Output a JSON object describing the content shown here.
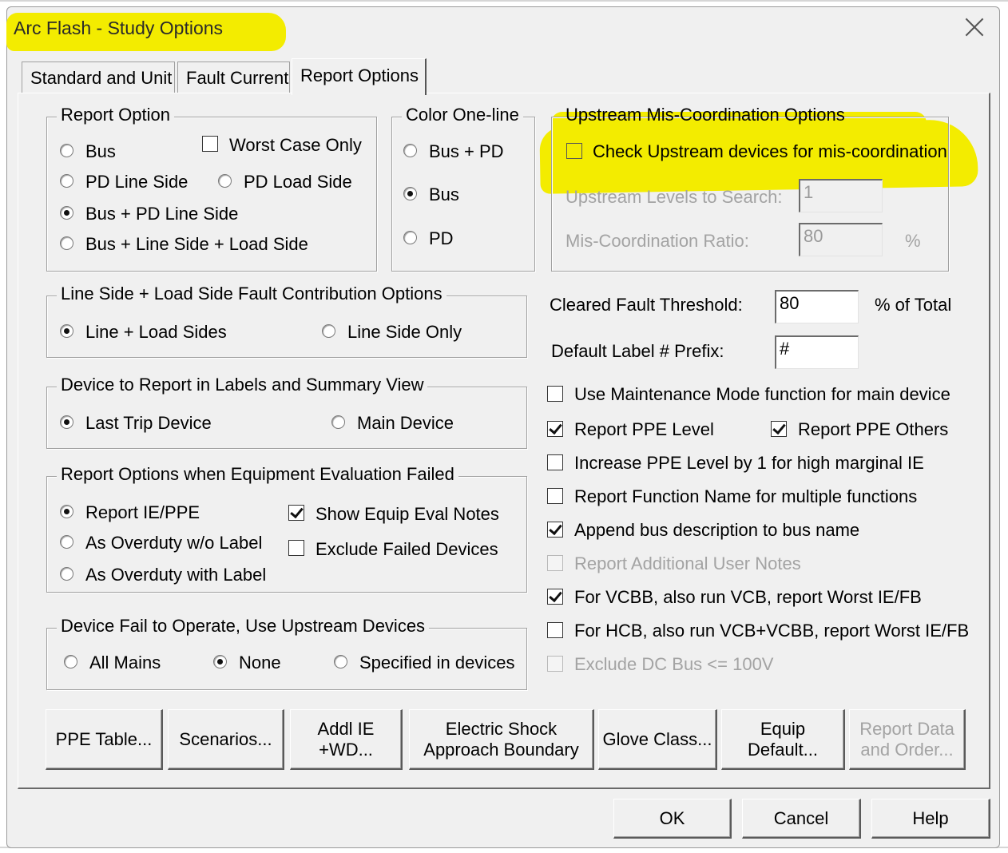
{
  "window": {
    "title": "Arc Flash - Study Options"
  },
  "tabs": [
    {
      "label": "Standard and Unit"
    },
    {
      "label": "Fault Current"
    },
    {
      "label": "Report Options"
    }
  ],
  "report_option": {
    "label": "Report Option",
    "bus": "Bus",
    "pd_line_side": "PD Line Side",
    "bus_pd_line_side": "Bus + PD Line Side",
    "bus_line_load": "Bus + Line Side + Load Side",
    "worst_case_only": "Worst Case Only",
    "pd_load_side": "PD Load Side",
    "selected": "Bus + PD Line Side"
  },
  "color_oneline": {
    "label": "Color One-line",
    "bus_pd": "Bus + PD",
    "bus": "Bus",
    "pd": "PD",
    "selected": "Bus"
  },
  "upstream": {
    "label": "Upstream Mis-Coordination Options",
    "check_label": "Check Upstream devices for mis-coordination",
    "levels_label": "Upstream Levels to Search:",
    "levels_value": "1",
    "ratio_label": "Mis-Coordination Ratio:",
    "ratio_value": "80",
    "ratio_unit": "%"
  },
  "line_load": {
    "label": "Line Side + Load Side Fault Contribution Options",
    "line_load_sides": "Line + Load Sides",
    "line_side_only": "Line Side Only",
    "selected": "Line + Load Sides"
  },
  "device_report": {
    "label": "Device to Report in Labels and Summary View",
    "last_trip": "Last Trip Device",
    "main_device": "Main Device",
    "selected": "Last Trip Device"
  },
  "equip_eval": {
    "label": "Report Options when Equipment Evaluation Failed",
    "report_ie_ppe": "Report IE/PPE",
    "overduty_no_label": "As Overduty w/o Label",
    "overduty_label": "As Overduty with Label",
    "show_notes": "Show Equip Eval Notes",
    "exclude_failed": "Exclude Failed Devices",
    "selected": "Report IE/PPE"
  },
  "device_fail": {
    "label": "Device Fail to Operate, Use Upstream Devices",
    "all_mains": "All Mains",
    "none": "None",
    "specified": "Specified in devices",
    "selected": "None"
  },
  "cleared_fault": {
    "label": "Cleared Fault Threshold:",
    "value": "80",
    "unit": "% of Total"
  },
  "label_prefix": {
    "label": "Default Label # Prefix:",
    "value": "#"
  },
  "options": {
    "maintenance_mode": "Use Maintenance Mode function for main device",
    "report_ppe_level": "Report PPE Level",
    "report_ppe_others": "Report PPE Others",
    "increase_ppe": "Increase PPE Level by 1 for high marginal IE",
    "report_function_name": "Report Function Name for multiple functions",
    "append_bus_desc": "Append bus description to bus name",
    "additional_notes": "Report Additional User Notes",
    "vcbb": "For VCBB, also run VCB, report Worst IE/FB",
    "hcb": "For HCB, also run VCB+VCBB, report Worst IE/FB",
    "exclude_dc": "Exclude DC Bus <= 100V"
  },
  "buttons": {
    "ppe_table": "PPE Table...",
    "scenarios": "Scenarios...",
    "addl_ie": "Addl IE\n+WD...",
    "electric_shock": "Electric Shock\nApproach Boundary",
    "glove_class": "Glove Class...",
    "equip_default": "Equip\nDefault...",
    "report_data": "Report Data\nand Order...",
    "ok": "OK",
    "cancel": "Cancel",
    "help": "Help"
  },
  "colors": {
    "highlight": "#f3ec00",
    "dialog_bg": "#f0f0f0"
  }
}
